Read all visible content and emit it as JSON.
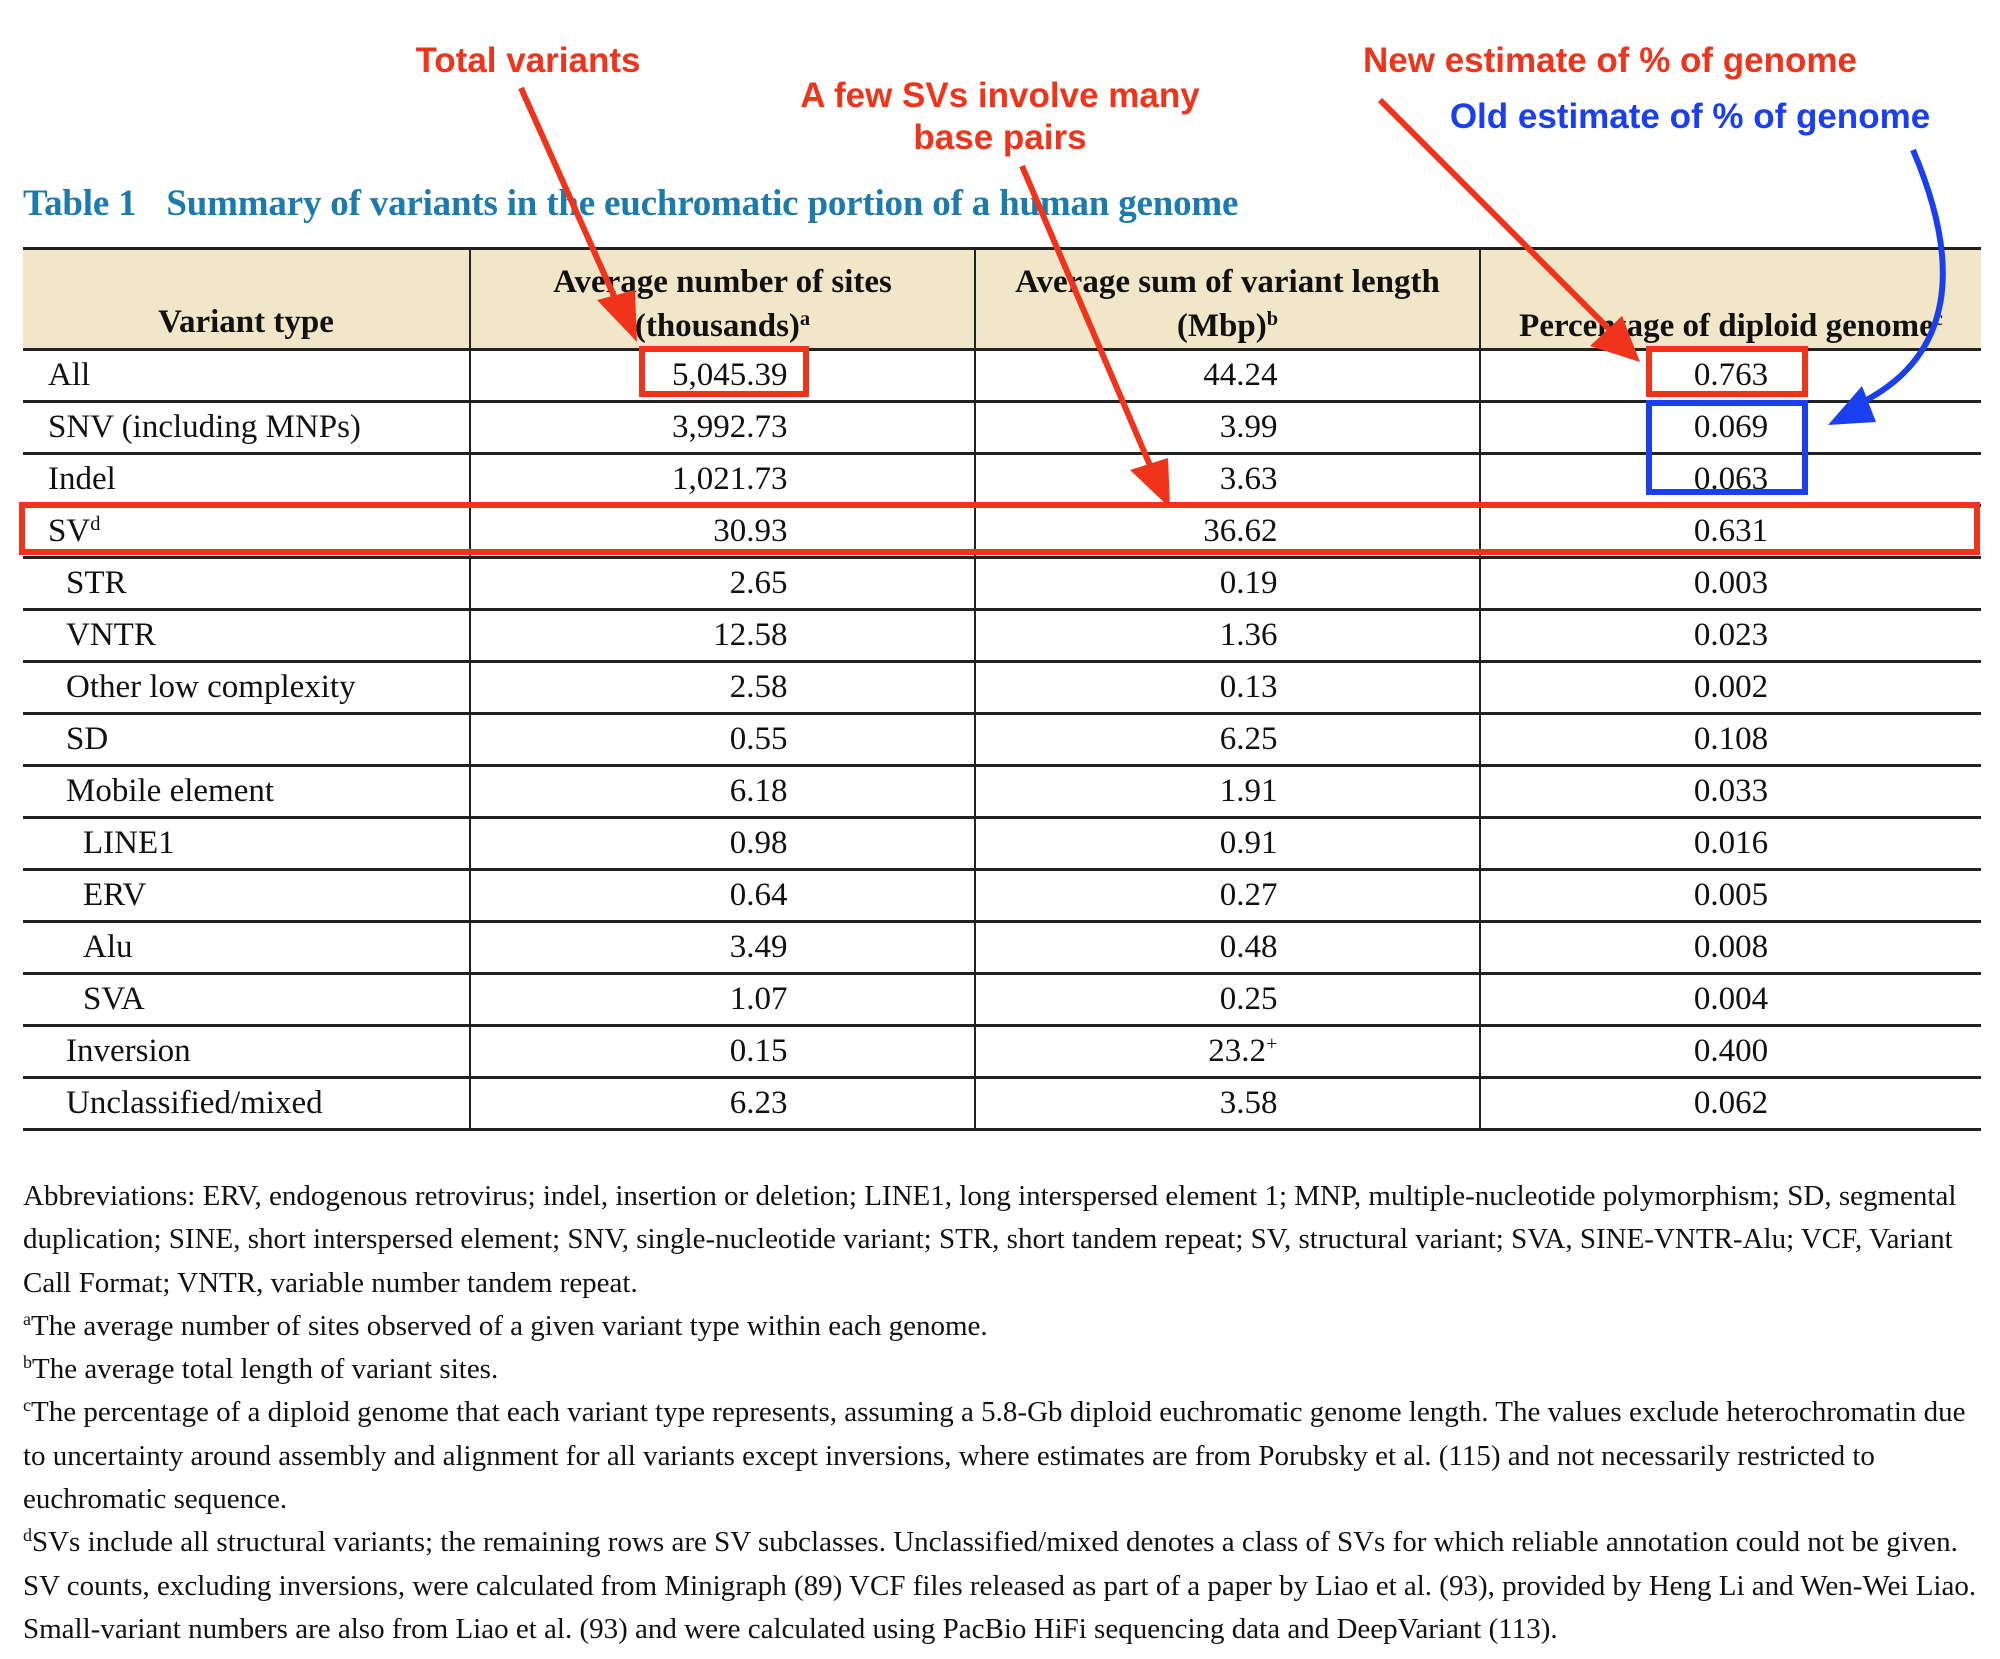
{
  "annotations": {
    "total_variants": "Total variants",
    "few_svs_line1": "A few SVs involve many",
    "few_svs_line2": "base pairs",
    "new_estimate": "New estimate of % of genome",
    "old_estimate": "Old estimate of % of genome",
    "colors": {
      "red": "#f0341b",
      "blue": "#1a3ff0"
    }
  },
  "table": {
    "number": "Table 1",
    "title": "Summary of variants in the euchromatic portion of a human genome",
    "title_color": "#1b7aae",
    "header_bg": "#f1e6c8",
    "headers": [
      {
        "text": "Variant type",
        "sup": ""
      },
      {
        "text": "Average number of sites (thousands)",
        "sup": "a"
      },
      {
        "text": "Average sum of variant length (Mbp)",
        "sup": "b"
      },
      {
        "text": "Percentage of diploid genome",
        "sup": "c"
      }
    ],
    "rows": [
      {
        "type": "All",
        "sup": "",
        "indent": 0,
        "sites": "5,045.39",
        "length": "44.24",
        "length_sup": "",
        "pct": "0.763"
      },
      {
        "type": "SNV (including MNPs)",
        "sup": "",
        "indent": 0,
        "sites": "3,992.73",
        "length": "3.99",
        "length_sup": "",
        "pct": "0.069"
      },
      {
        "type": "Indel",
        "sup": "",
        "indent": 0,
        "sites": "1,021.73",
        "length": "3.63",
        "length_sup": "",
        "pct": "0.063"
      },
      {
        "type": "SV",
        "sup": "d",
        "indent": 0,
        "sites": "30.93",
        "length": "36.62",
        "length_sup": "",
        "pct": "0.631"
      },
      {
        "type": "STR",
        "sup": "",
        "indent": 1,
        "sites": "2.65",
        "length": "0.19",
        "length_sup": "",
        "pct": "0.003"
      },
      {
        "type": "VNTR",
        "sup": "",
        "indent": 1,
        "sites": "12.58",
        "length": "1.36",
        "length_sup": "",
        "pct": "0.023"
      },
      {
        "type": "Other low complexity",
        "sup": "",
        "indent": 1,
        "sites": "2.58",
        "length": "0.13",
        "length_sup": "",
        "pct": "0.002"
      },
      {
        "type": "SD",
        "sup": "",
        "indent": 1,
        "sites": "0.55",
        "length": "6.25",
        "length_sup": "",
        "pct": "0.108"
      },
      {
        "type": "Mobile element",
        "sup": "",
        "indent": 1,
        "sites": "6.18",
        "length": "1.91",
        "length_sup": "",
        "pct": "0.033"
      },
      {
        "type": "LINE1",
        "sup": "",
        "indent": 2,
        "sites": "0.98",
        "length": "0.91",
        "length_sup": "",
        "pct": "0.016"
      },
      {
        "type": "ERV",
        "sup": "",
        "indent": 2,
        "sites": "0.64",
        "length": "0.27",
        "length_sup": "",
        "pct": "0.005"
      },
      {
        "type": "Alu",
        "sup": "",
        "indent": 2,
        "sites": "3.49",
        "length": "0.48",
        "length_sup": "",
        "pct": "0.008"
      },
      {
        "type": "SVA",
        "sup": "",
        "indent": 2,
        "sites": "1.07",
        "length": "0.25",
        "length_sup": "",
        "pct": "0.004"
      },
      {
        "type": "Inversion",
        "sup": "",
        "indent": 1,
        "sites": "0.15",
        "length": "23.2",
        "length_sup": "+",
        "pct": "0.400"
      },
      {
        "type": "Unclassified/mixed",
        "sup": "",
        "indent": 1,
        "sites": "6.23",
        "length": "3.58",
        "length_sup": "",
        "pct": "0.062"
      }
    ]
  },
  "footnotes": {
    "abbreviations": "Abbreviations: ERV, endogenous retrovirus; indel, insertion or deletion; LINE1, long interspersed element 1; MNP, multiple-nucleotide polymorphism; SD, segmental duplication; SINE, short interspersed element; SNV, single-nucleotide variant; STR, short tandem repeat; SV, structural variant; SVA, SINE-VNTR-Alu; VCF, Variant Call Format; VNTR, variable number tandem repeat.",
    "notes": [
      {
        "mark": "a",
        "text": "The average number of sites observed of a given variant type within each genome."
      },
      {
        "mark": "b",
        "text": "The average total length of variant sites."
      },
      {
        "mark": "c",
        "text": "The percentage of a diploid genome that each variant type represents, assuming a 5.8-Gb diploid euchromatic genome length. The values exclude heterochromatin due to uncertainty around assembly and alignment for all variants except inversions, where estimates are from Porubsky et al. (115) and not necessarily restricted to euchromatic sequence."
      },
      {
        "mark": "d",
        "text": "SVs include all structural variants; the remaining rows are SV subclasses. Unclassified/mixed denotes a class of SVs for which reliable annotation could not be given. SV counts, excluding inversions, were calculated from Minigraph (89) VCF files released as part of a paper by Liao et al. (93), provided by Heng Li and Wen-Wei Liao. Small-variant numbers are also from Liao et al. (93) and were calculated using PacBio HiFi sequencing data and DeepVariant (113)."
      }
    ]
  }
}
